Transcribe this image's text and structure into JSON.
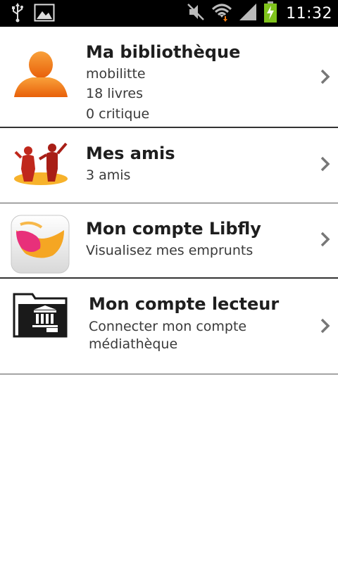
{
  "status_bar": {
    "time": "11:32",
    "icons": [
      "usb-icon",
      "image-notification-icon",
      "mute-icon",
      "wifi-icon",
      "signal-icon",
      "battery-charging-icon"
    ]
  },
  "menu": {
    "items": [
      {
        "title": "Ma bibliothèque",
        "lines": [
          "mobilitte",
          "18 livres",
          "0 critique"
        ],
        "icon": "user-avatar-icon"
      },
      {
        "title": "Mes amis",
        "lines": [
          "3 amis"
        ],
        "icon": "friends-icon"
      },
      {
        "title": "Mon compte Libfly",
        "lines": [
          "Visualisez mes emprunts"
        ],
        "icon": "libfly-app-icon"
      },
      {
        "title": "Mon compte lecteur",
        "lines": [
          "Connecter mon compte",
          "médiathèque"
        ],
        "icon": "library-folder-icon"
      }
    ]
  },
  "colors": {
    "status_bar": "#000000",
    "avatar_orange": "#f07a10",
    "friends_red": "#c0281c",
    "libfly_pink": "#e8307a",
    "libfly_orange": "#f5a623"
  }
}
